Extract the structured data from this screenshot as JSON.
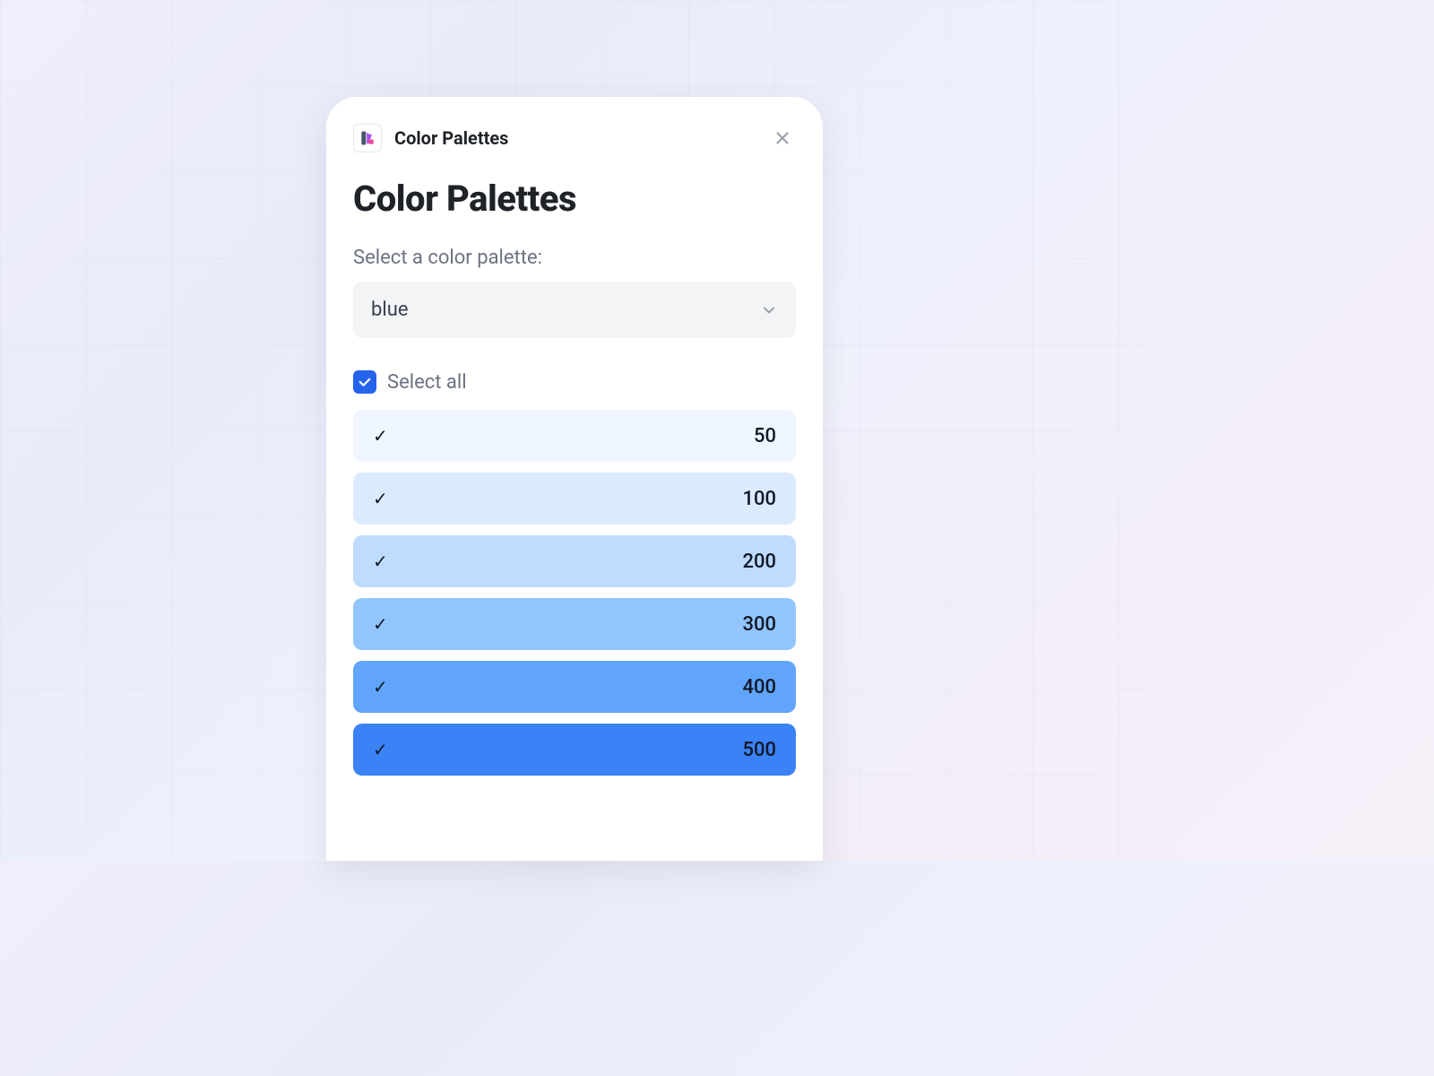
{
  "header": {
    "tab_title": "Color Palettes"
  },
  "page": {
    "title": "Color Palettes",
    "select_label": "Select a color palette:",
    "select_value": "blue",
    "select_all_label": "Select all",
    "select_all_checked": true
  },
  "swatches": [
    {
      "label": "50",
      "color": "#eff6ff",
      "checked": true
    },
    {
      "label": "100",
      "color": "#dbeafe",
      "checked": true
    },
    {
      "label": "200",
      "color": "#bfdbfe",
      "checked": true
    },
    {
      "label": "300",
      "color": "#93c5fd",
      "checked": true
    },
    {
      "label": "400",
      "color": "#60a5fa",
      "checked": true
    },
    {
      "label": "500",
      "color": "#3b82f6",
      "checked": true
    }
  ]
}
